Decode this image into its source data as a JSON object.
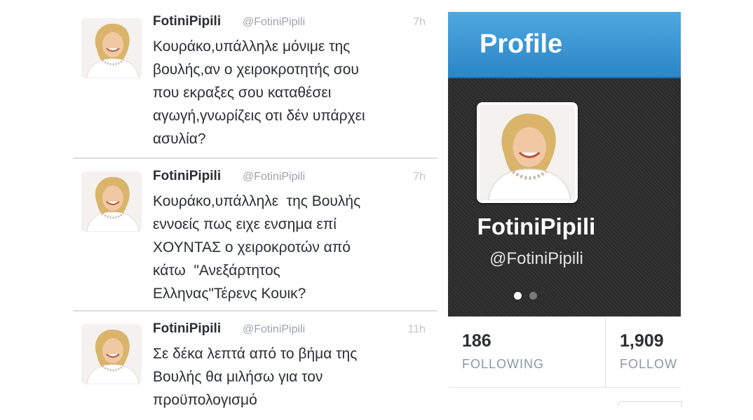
{
  "tweets": [
    {
      "name": "FotiniPipili",
      "handle": "@FotiniPipili",
      "time": "7h",
      "text": "Κουράκο,υπάλληλε μόνιμε της\nβουλής,αν ο χειροκροτητής σου\nπου εκραξες σου καταθέσει\nαγωγή,γνωρίζεις οτι δέν υπάρχει\nασυλία?"
    },
    {
      "name": "FotiniPipili",
      "handle": "@FotiniPipili",
      "time": "7h",
      "text": "Κουράκο,υπάλληλε  της Βουλής\nεννοείς πως ειχε ενσημα επί\nΧΟΥΝΤΑΣ ο χειροκροτών από\nκάτω  \"Ανεξάρτητος\nΕλληνας\"Τέρενς Κουικ?"
    },
    {
      "name": "FotiniPipili",
      "handle": "@FotiniPipili",
      "time": "11h",
      "text": "Σε δέκα λεπτά από το βήμα της\nΒουλής θα μιλήσω για τον\nπροϋπολογισμό"
    }
  ],
  "profile": {
    "title": "Profile",
    "name": "FotiniPipili",
    "handle": "@FotiniPipili",
    "stats": [
      {
        "value": "186",
        "label": "FOLLOWING"
      },
      {
        "value": "1,909",
        "label": "FOLLOW"
      }
    ]
  },
  "colors": {
    "header_blue": "#3b96d6",
    "card_dark": "#303030",
    "text_dark": "#292f33",
    "text_muted": "#9da3a8"
  },
  "icons": {
    "avatar": "woman-portrait-photo"
  }
}
